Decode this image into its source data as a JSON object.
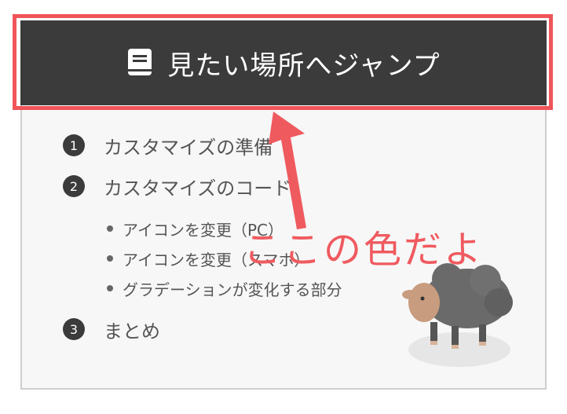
{
  "toc": {
    "title": "見たい場所へジャンプ",
    "items": [
      {
        "number": "1",
        "label": "カスタマイズの準備"
      },
      {
        "number": "2",
        "label": "カスタマイズのコード",
        "children": [
          "アイコンを変更（PC）",
          "アイコンを変更（スマホ）",
          "グラデーションが変化する部分"
        ]
      },
      {
        "number": "3",
        "label": "まとめ"
      }
    ]
  },
  "annotation": {
    "text": "ここの色だよ"
  },
  "colors": {
    "header_bg": "#3b3b3b",
    "highlight": "#f0555a",
    "annotation": "#ef5a5f"
  },
  "icons": {
    "header": "book-icon",
    "decoration": "sheep-illustration"
  }
}
